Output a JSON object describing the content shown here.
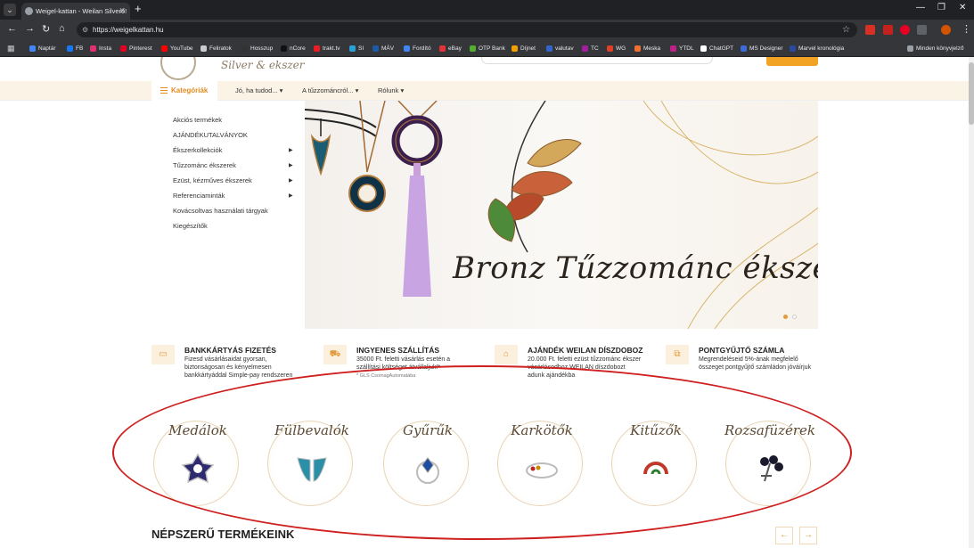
{
  "browser": {
    "tab_title": "Weigel-kattan - Weilan Silverő!",
    "new_tab": "+",
    "url": "https://weigelkattan.hu",
    "bookmarks": [
      {
        "label": "Naptár",
        "color": "#4285f4"
      },
      {
        "label": "FB",
        "color": "#1877f2"
      },
      {
        "label": "Insta",
        "color": "#e1306c"
      },
      {
        "label": "Pinterest",
        "color": "#e60023"
      },
      {
        "label": "YouTube",
        "color": "#ff0000"
      },
      {
        "label": "Feliratok",
        "color": "#cccccc"
      },
      {
        "label": "Hosszup",
        "color": "#333333"
      },
      {
        "label": "nCore",
        "color": "#111111"
      },
      {
        "label": "trakt.tv",
        "color": "#ed1c24"
      },
      {
        "label": "SI",
        "color": "#2aa1d6"
      },
      {
        "label": "MÁV",
        "color": "#1c5aa8"
      },
      {
        "label": "Fordító",
        "color": "#4285f4"
      },
      {
        "label": "eBay",
        "color": "#e53238"
      },
      {
        "label": "OTP Bank",
        "color": "#52ae30"
      },
      {
        "label": "Díjnet",
        "color": "#f0a000"
      },
      {
        "label": "valutav",
        "color": "#3366cc"
      },
      {
        "label": "TC",
        "color": "#a020a0"
      },
      {
        "label": "WG",
        "color": "#e0402a"
      },
      {
        "label": "Meska",
        "color": "#f07030"
      },
      {
        "label": "YTDL",
        "color": "#c0208a"
      },
      {
        "label": "ChatGPT",
        "color": "#ffffff"
      },
      {
        "label": "MS Designer",
        "color": "#3a6bd6"
      },
      {
        "label": "Marvel kronológia",
        "color": "#2a4aa0"
      }
    ],
    "other_bookmarks": "Minden könyvjelző"
  },
  "site": {
    "logo_text": "Silver & ekszer",
    "menu": {
      "categories": "Kategóriák",
      "items": [
        "Jó, ha tudod...",
        "A tűzzománcról...",
        "Rólunk"
      ]
    },
    "sidebar": [
      {
        "label": "Akciós termékek",
        "arrow": false
      },
      {
        "label": "AJÁNDÉKUTALVÁNYOK",
        "arrow": false
      },
      {
        "label": "Ékszerkollekciók",
        "arrow": true
      },
      {
        "label": "Tűzzománc ékszerek",
        "arrow": true
      },
      {
        "label": "Ezüst, kézműves ékszerek",
        "arrow": true
      },
      {
        "label": "Referenciaminták",
        "arrow": true
      },
      {
        "label": "Kovácsoltvas használati tárgyak",
        "arrow": false
      },
      {
        "label": "Kiegészítők",
        "arrow": false
      }
    ],
    "hero": {
      "title": "Bronz Tűzzománc ékszerek"
    },
    "features": [
      {
        "title": "BANKKÁRTYÁS FIZETÉS",
        "text": "Fizesd vásárlásaidat gyorsan, biztonságosan és kényelmesen bankkártyáddal Simple-pay rendszeren",
        "note": ""
      },
      {
        "title": "INGYENES SZÁLLÍTÁS",
        "text": "35000 Ft. feletti vásárlás esetén a szállítási költséget átvállaljuk!*",
        "note": "* GLS CsomagAutomatába"
      },
      {
        "title": "AJÁNDÉK WEILAN DÍSZDOBOZ",
        "text": "20.000 Ft. feletti ezüst tűzzománc ékszer vásárlásodhoz WEILAN díszdobozt adunk ajándékba",
        "note": ""
      },
      {
        "title": "PONTGYŰJTŐ SZÁMLA",
        "text": "Megrendeléseid 5%-ának megfelelő összeget pontgyűjtő számládon jóváírjuk",
        "note": ""
      }
    ],
    "categories": [
      "Medálok",
      "Fülbevalók",
      "Gyűrűk",
      "Karkötők",
      "Kitűzők",
      "Rozsafüzérek"
    ],
    "popular_title": "NÉPSZERŰ TERMÉKEINK"
  }
}
